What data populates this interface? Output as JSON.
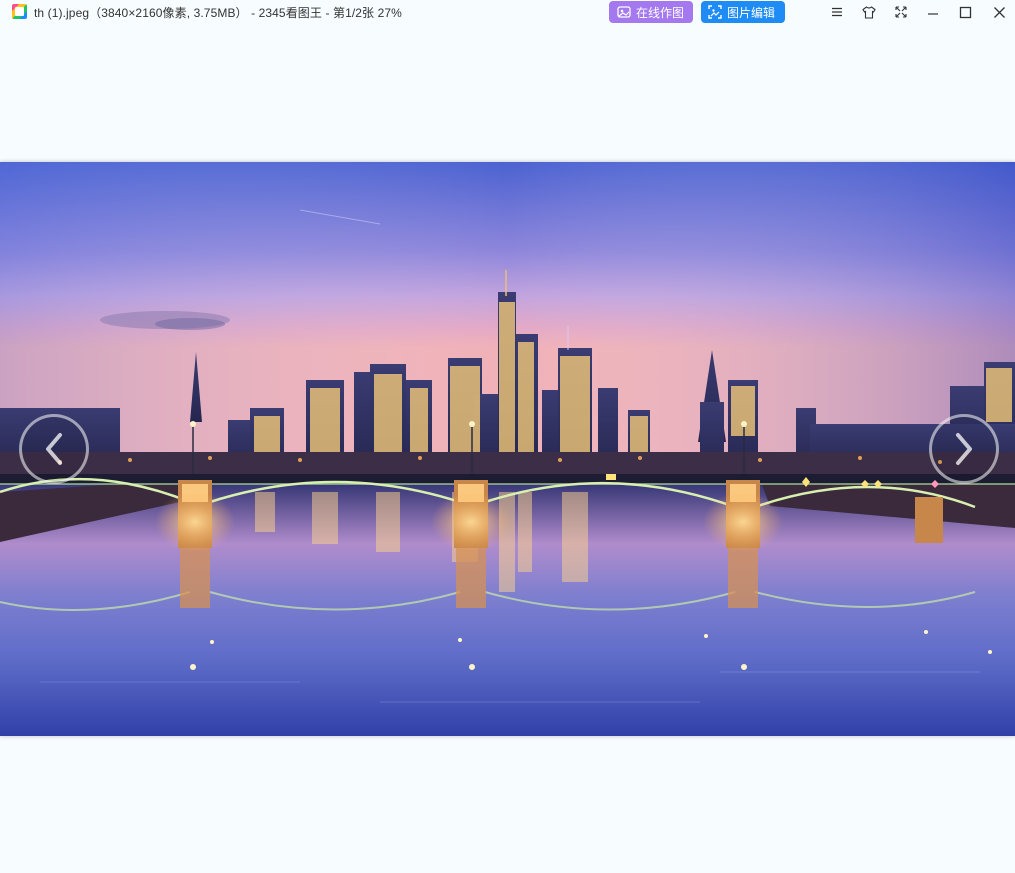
{
  "window": {
    "title": "th (1).jpeg（3840×2160像素, 3.75MB） - 2345看图王 - 第1/2张 27%"
  },
  "toolbar": {
    "online_design_label": "在线作图",
    "image_edit_label": "图片编辑"
  },
  "window_controls": [
    "menu-icon",
    "skin-icon",
    "fullscreen-icon",
    "minimize-icon",
    "maximize-icon",
    "close-icon"
  ],
  "viewer": {
    "image_subject": "city skyline at dusk with lit bridge over river",
    "prev_icon": "chevron-left-icon",
    "next_icon": "chevron-right-icon"
  },
  "colors": {
    "online_button": "#a479ef",
    "edit_button": "#1e8cf4",
    "background": "#f7fcff"
  }
}
